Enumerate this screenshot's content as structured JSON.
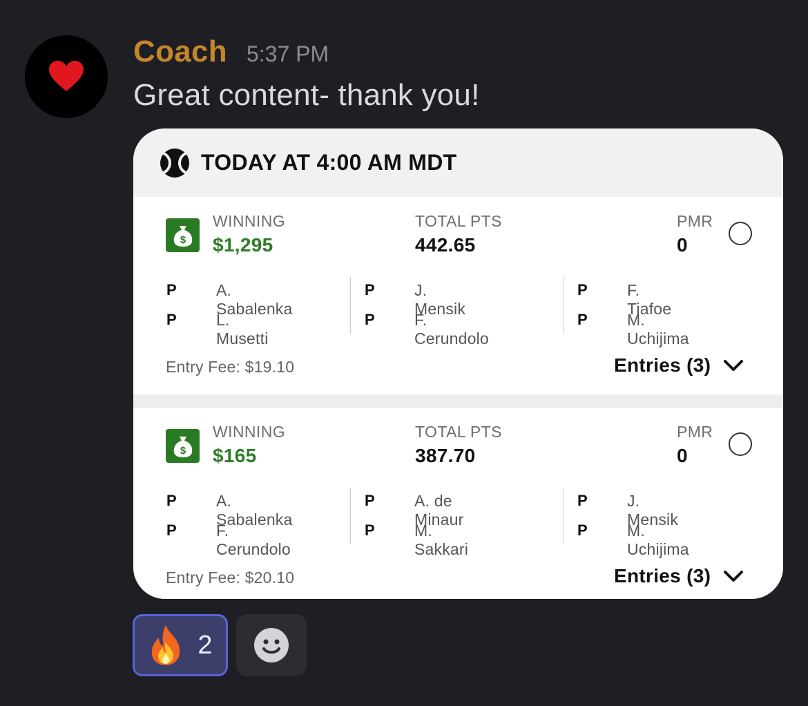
{
  "message": {
    "username": "Coach",
    "timestamp": "5:37 PM",
    "text": "Great content- thank you!",
    "avatar_icon": "heart-icon"
  },
  "card": {
    "title": "TODAY AT 4:00 AM MDT",
    "icon": "tennis-ball-icon",
    "entries": [
      {
        "winning_label": "WINNING",
        "winning_value": "$1,295",
        "total_label": "TOTAL PTS",
        "total_value": "442.65",
        "pmr_label": "PMR",
        "pmr_value": "0",
        "players": [
          {
            "pos": "P",
            "name": "A. Sabalenka"
          },
          {
            "pos": "P",
            "name": "L. Musetti"
          },
          {
            "pos": "P",
            "name": "J. Mensik"
          },
          {
            "pos": "P",
            "name": "F. Cerundolo"
          },
          {
            "pos": "P",
            "name": "F. Tiafoe"
          },
          {
            "pos": "P",
            "name": "M. Uchijima"
          }
        ],
        "entry_fee": "Entry Fee: $19.10",
        "entries_label": "Entries (3)"
      },
      {
        "winning_label": "WINNING",
        "winning_value": "$165",
        "total_label": "TOTAL PTS",
        "total_value": "387.70",
        "pmr_label": "PMR",
        "pmr_value": "0",
        "players": [
          {
            "pos": "P",
            "name": "A. Sabalenka"
          },
          {
            "pos": "P",
            "name": "F. Cerundolo"
          },
          {
            "pos": "P",
            "name": "A. de Minaur"
          },
          {
            "pos": "P",
            "name": "M. Sakkari"
          },
          {
            "pos": "P",
            "name": "J. Mensik"
          },
          {
            "pos": "P",
            "name": "M. Uchijima"
          }
        ],
        "entry_fee": "Entry Fee: $20.10",
        "entries_label": "Entries (3)"
      }
    ]
  },
  "reactions": [
    {
      "emoji": "fire-icon",
      "count": "2"
    },
    {
      "emoji": "add-reaction-icon"
    }
  ],
  "colors": {
    "background": "#1e1f24",
    "username": "#c5862b",
    "winning": "#2e7d28",
    "reaction_border": "#5a63d6"
  }
}
